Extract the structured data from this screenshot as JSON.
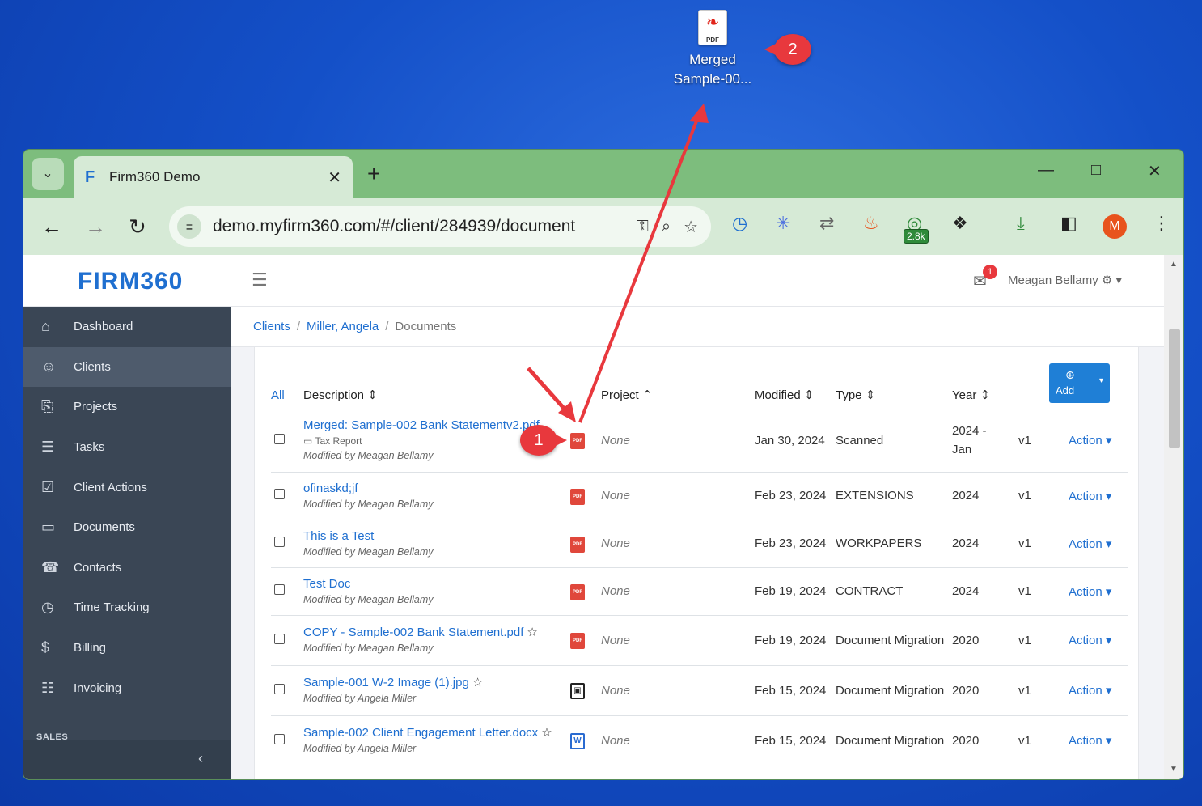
{
  "desktop": {
    "icon_file_label": "PDF",
    "icon_name_line1": "Merged",
    "icon_name_line2": "Sample-00...",
    "callout_1": "1",
    "callout_2": "2"
  },
  "browser": {
    "tab_title": "Firm360 Demo",
    "url": "demo.myfirm360.com/#/client/284939/document",
    "extension_badge": "2.8k",
    "profile_initial": "M"
  },
  "app": {
    "logo": "FIRM360",
    "mail_count": "1",
    "user_name": "Meagan Bellamy",
    "sidebar": {
      "items": [
        {
          "label": "Dashboard",
          "icon": "home-icon"
        },
        {
          "label": "Clients",
          "icon": "users-icon"
        },
        {
          "label": "Projects",
          "icon": "clipboard-icon"
        },
        {
          "label": "Tasks",
          "icon": "list-icon"
        },
        {
          "label": "Client Actions",
          "icon": "checkbox-icon"
        },
        {
          "label": "Documents",
          "icon": "folder-icon"
        },
        {
          "label": "Contacts",
          "icon": "phone-icon"
        },
        {
          "label": "Time Tracking",
          "icon": "clock-icon"
        },
        {
          "label": "Billing",
          "icon": "dollar-icon"
        },
        {
          "label": "Invoicing",
          "icon": "invoice-icon"
        }
      ],
      "section_label": "SALES",
      "active_index": 1
    },
    "breadcrumb": {
      "clients": "Clients",
      "client": "Miller, Angela",
      "current": "Documents",
      "separator": "/"
    },
    "table": {
      "headers": {
        "all": "All",
        "description": "Description",
        "project": "Project",
        "modified": "Modified",
        "type": "Type",
        "year": "Year"
      },
      "add_button": "Add",
      "rows": [
        {
          "title": "Merged: Sample-002 Bank Statementv2.pdf",
          "folder": "Tax Report",
          "modified_by": "Modified by Meagan Bellamy",
          "project": "None",
          "modified": "Jan 30, 2024",
          "type": "Scanned",
          "year": "2024 - Jan",
          "version": "v1",
          "action": "Action",
          "file_type": "pdf"
        },
        {
          "title": "ofinaskd;jf",
          "folder": "",
          "modified_by": "Modified by Meagan Bellamy",
          "project": "None",
          "modified": "Feb 23, 2024",
          "type": "EXTENSIONS",
          "year": "2024",
          "version": "v1",
          "action": "Action",
          "file_type": "pdf"
        },
        {
          "title": "This is a Test",
          "folder": "",
          "modified_by": "Modified by Meagan Bellamy",
          "project": "None",
          "modified": "Feb 23, 2024",
          "type": "WORKPAPERS",
          "year": "2024",
          "version": "v1",
          "action": "Action",
          "file_type": "pdf"
        },
        {
          "title": "Test Doc",
          "folder": "",
          "modified_by": "Modified by Meagan Bellamy",
          "project": "None",
          "modified": "Feb 19, 2024",
          "type": "CONTRACT",
          "year": "2024",
          "version": "v1",
          "action": "Action",
          "file_type": "pdf"
        },
        {
          "title": "COPY - Sample-002 Bank Statement.pdf",
          "folder": "",
          "modified_by": "Modified by Meagan Bellamy",
          "project": "None",
          "modified": "Feb 19, 2024",
          "type": "Document Migration",
          "year": "2020",
          "version": "v1",
          "action": "Action",
          "file_type": "pdf"
        },
        {
          "title": "Sample-001 W-2 Image (1).jpg",
          "folder": "",
          "modified_by": "Modified by Angela Miller",
          "project": "None",
          "modified": "Feb 15, 2024",
          "type": "Document Migration",
          "year": "2020",
          "version": "v1",
          "action": "Action",
          "file_type": "image"
        },
        {
          "title": "Sample-002 Client Engagement Letter.docx",
          "folder": "",
          "modified_by": "Modified by Angela Miller",
          "project": "None",
          "modified": "Feb 15, 2024",
          "type": "Document Migration",
          "year": "2020",
          "version": "v1",
          "action": "Action",
          "file_type": "word"
        }
      ]
    }
  }
}
